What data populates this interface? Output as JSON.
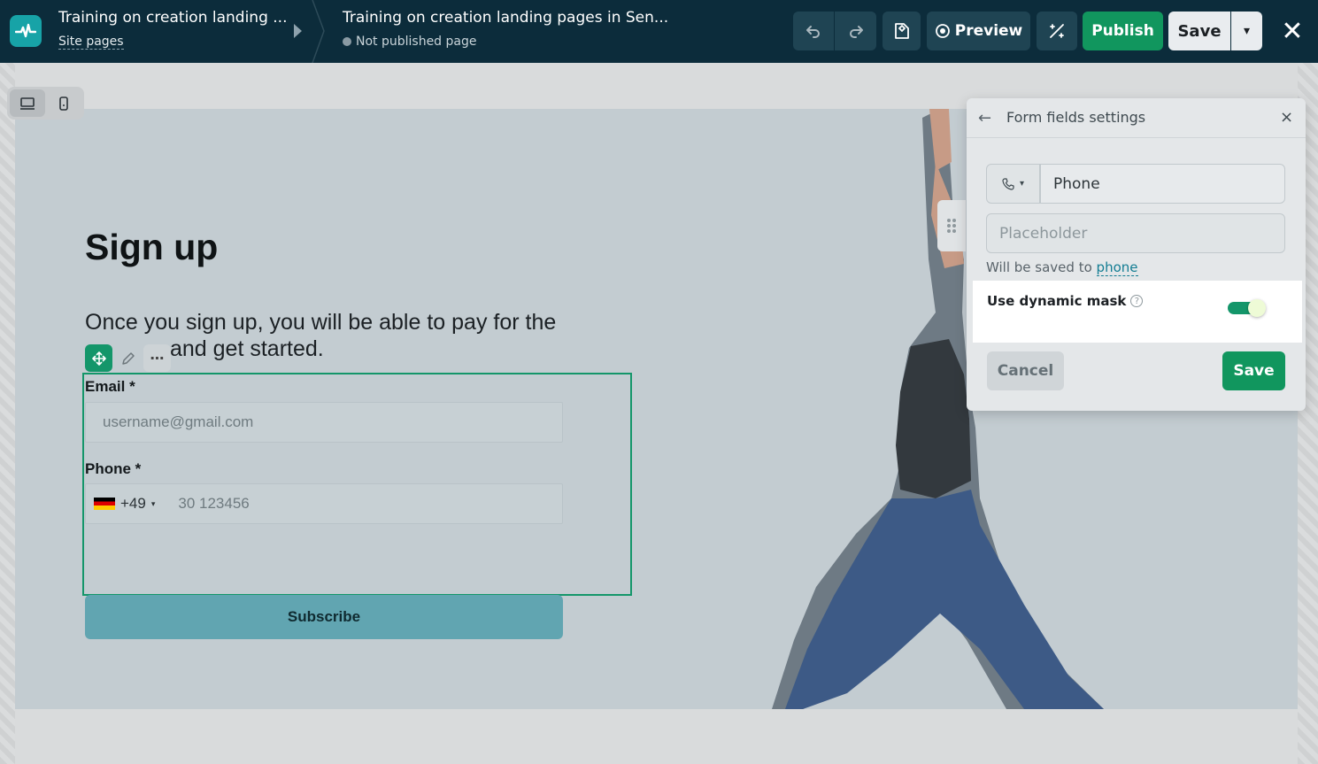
{
  "header": {
    "site_title": "Training on creation landing ...",
    "site_pages_link": "Site pages",
    "page_title": "Training on creation landing pages in Sen...",
    "page_status": "Not published page",
    "preview_label": "Preview",
    "publish_label": "Publish",
    "save_label": "Save",
    "close_glyph": "✕"
  },
  "page": {
    "heading": "Sign up",
    "subheading": "Once you sign up, you will be able to pay for the",
    "subheading_line2": "and get started.",
    "form": {
      "email_label": "Email *",
      "email_placeholder": "username@gmail.com",
      "phone_label": "Phone *",
      "phone_country_code": "+49",
      "phone_placeholder": "30 123456",
      "submit_label": "Subscribe"
    }
  },
  "panel": {
    "title": "Form fields settings",
    "back_glyph": "←",
    "close_glyph": "×",
    "field_name": "Phone",
    "placeholder_hint": "Placeholder",
    "saved_to_prefix": "Will be saved to",
    "saved_to_field": "phone",
    "dynamic_mask_label": "Use dynamic mask",
    "help_glyph": "?",
    "cancel_label": "Cancel",
    "save_label": "Save",
    "dynamic_mask_enabled": true
  },
  "colors": {
    "topbar": "#0c2c3b",
    "brand": "#17a3a7",
    "primary_green": "#11965e",
    "subscribe_button": "#61a5b1",
    "link": "#137d93"
  },
  "icons": [
    "logo-pulse-icon",
    "undo-icon",
    "redo-icon",
    "layers-icon",
    "eye-icon",
    "magic-wand-icon",
    "chevron-down-icon",
    "close-icon",
    "desktop-icon",
    "mobile-icon",
    "move-icon",
    "pencil-icon",
    "more-icon",
    "drag-handle-icon",
    "phone-icon",
    "back-arrow-icon",
    "help-icon"
  ]
}
